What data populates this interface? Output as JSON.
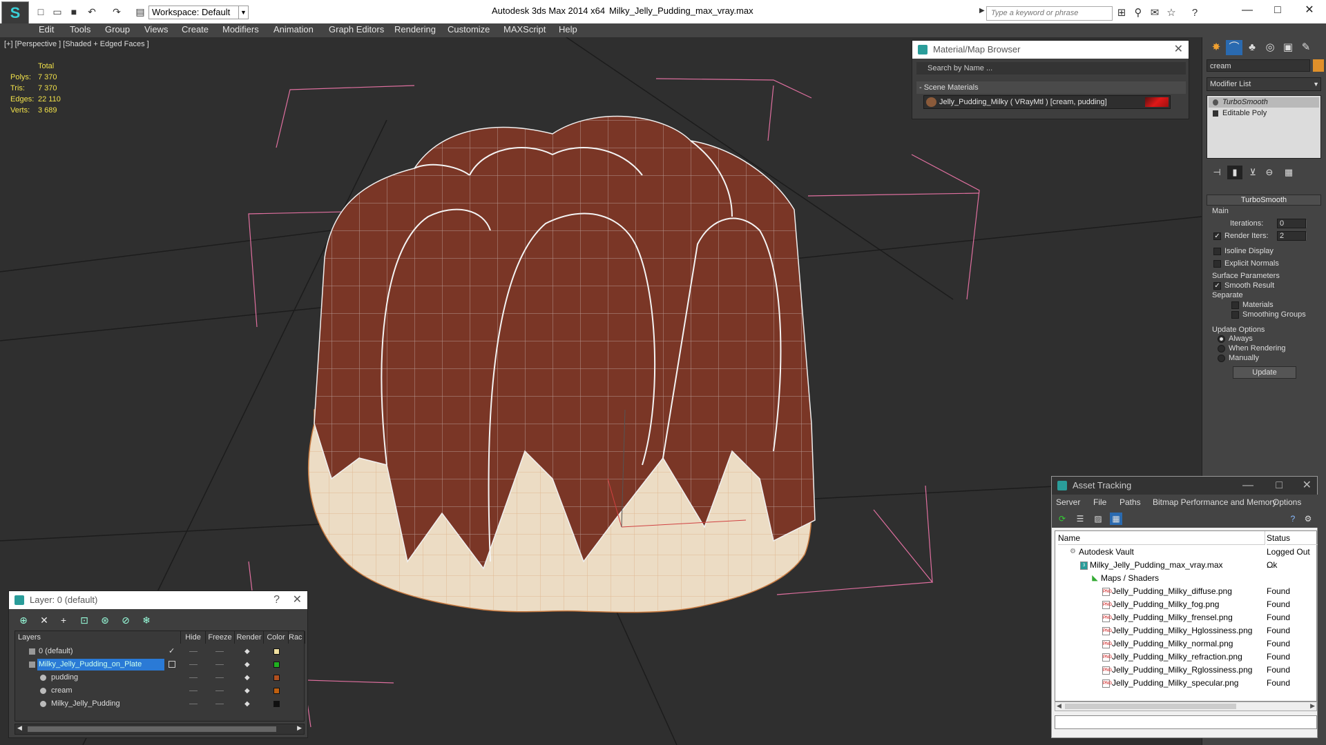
{
  "titlebar": {
    "workspace": "Workspace: Default",
    "app_title": "Autodesk 3ds Max  2014 x64",
    "file_title": "Milky_Jelly_Pudding_max_vray.max",
    "search_placeholder": "Type a keyword or phrase"
  },
  "menu": [
    "Edit",
    "Tools",
    "Group",
    "Views",
    "Create",
    "Modifiers",
    "Animation",
    "Graph Editors",
    "Rendering",
    "Customize",
    "MAXScript",
    "Help"
  ],
  "viewport": {
    "label": "[+] [Perspective ] [Shaded + Edged Faces ]",
    "stats": {
      "header": "Total",
      "rows": [
        {
          "key": "Polys:",
          "value": "7 370"
        },
        {
          "key": "Tris:",
          "value": "7 370"
        },
        {
          "key": "Edges:",
          "value": "22 110"
        },
        {
          "key": "Verts:",
          "value": "3 689"
        }
      ]
    }
  },
  "material_browser": {
    "title": "Material/Map Browser",
    "search_placeholder": "Search by Name ...",
    "group": "- Scene Materials",
    "item": "Jelly_Pudding_Milky  ( VRayMtl ) [cream, pudding]"
  },
  "command_panel": {
    "object_name": "cream",
    "modifier_list": "Modifier List",
    "stack": [
      {
        "label": "TurboSmooth",
        "selected": true
      },
      {
        "label": "Editable Poly",
        "selected": false
      }
    ],
    "rollout_title": "TurboSmooth",
    "main_label": "Main",
    "iterations_label": "Iterations:",
    "iterations_value": "0",
    "render_iters_label": "Render Iters:",
    "render_iters_value": "2",
    "render_iters_checked": true,
    "isoline_label": "Isoline Display",
    "explicit_label": "Explicit Normals",
    "surface_label": "Surface Parameters",
    "smooth_label": "Smooth Result",
    "smooth_checked": true,
    "separate_label": "Separate",
    "materials_label": "Materials",
    "smoothing_groups_label": "Smoothing Groups",
    "update_options_label": "Update Options",
    "always_label": "Always",
    "when_rendering_label": "When Rendering",
    "manually_label": "Manually",
    "update_button": "Update"
  },
  "layer_panel": {
    "title": "Layer: 0 (default)",
    "headers": [
      "Layers",
      "Hide",
      "Freeze",
      "Render",
      "Color",
      "Rac"
    ],
    "rows": [
      {
        "name": "0 (default)",
        "color": "#f0e0a0",
        "indent": 0,
        "selected": false
      },
      {
        "name": "Milky_Jelly_Pudding_on_Plate",
        "color": "#20b020",
        "indent": 0,
        "selected": true
      },
      {
        "name": "pudding",
        "color": "#b05020",
        "indent": 1,
        "selected": false
      },
      {
        "name": "cream",
        "color": "#c06010",
        "indent": 1,
        "selected": false
      },
      {
        "name": "Milky_Jelly_Pudding",
        "color": "#101010",
        "indent": 1,
        "selected": false
      }
    ]
  },
  "asset_tracking": {
    "title": "Asset Tracking",
    "menu": [
      "Server",
      "File",
      "Paths",
      "Bitmap Performance and Memory",
      "Options"
    ],
    "headers": {
      "name": "Name",
      "status": "Status"
    },
    "rows": [
      {
        "name": "Autodesk Vault",
        "status": "Logged Out ...",
        "indent": 0
      },
      {
        "name": "Milky_Jelly_Pudding_max_vray.max",
        "status": "Ok",
        "indent": 1
      },
      {
        "name": "Maps / Shaders",
        "status": "",
        "indent": 2
      },
      {
        "name": "Jelly_Pudding_Milky_diffuse.png",
        "status": "Found",
        "indent": 3
      },
      {
        "name": "Jelly_Pudding_Milky_fog.png",
        "status": "Found",
        "indent": 3
      },
      {
        "name": "Jelly_Pudding_Milky_frensel.png",
        "status": "Found",
        "indent": 3
      },
      {
        "name": "Jelly_Pudding_Milky_Hglossiness.png",
        "status": "Found",
        "indent": 3
      },
      {
        "name": "Jelly_Pudding_Milky_normal.png",
        "status": "Found",
        "indent": 3
      },
      {
        "name": "Jelly_Pudding_Milky_refraction.png",
        "status": "Found",
        "indent": 3
      },
      {
        "name": "Jelly_Pudding_Milky_Rglossiness.png",
        "status": "Found",
        "indent": 3
      },
      {
        "name": "Jelly_Pudding_Milky_specular.png",
        "status": "Found",
        "indent": 3
      }
    ]
  }
}
